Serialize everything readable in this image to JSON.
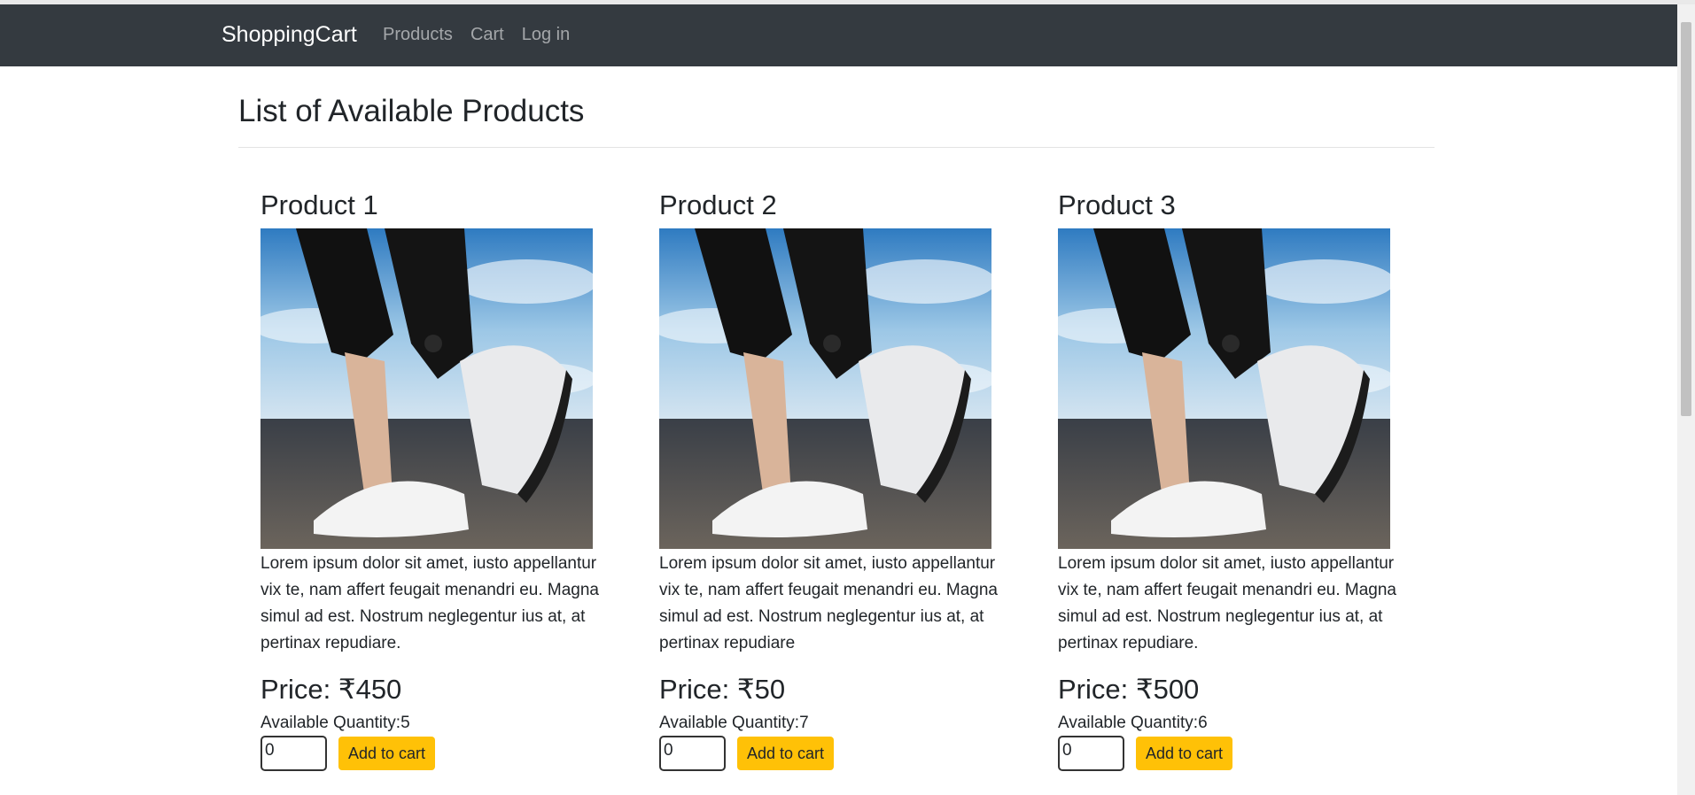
{
  "navbar": {
    "brand": "ShoppingCart",
    "links": [
      "Products",
      "Cart",
      "Log in"
    ]
  },
  "page": {
    "title": "List of Available Products"
  },
  "products": [
    {
      "name": "Product 1",
      "description": "Lorem ipsum dolor sit amet, iusto appellantur vix te, nam affert feugait menandri eu. Magna simul ad est. Nostrum neglegentur ius at, at pertinax repudiare.",
      "price": "Price: ₹450",
      "quantity": "Available Quantity:5",
      "input_value": "0",
      "button_label": "Add to cart"
    },
    {
      "name": "Product 2",
      "description": "Lorem ipsum dolor sit amet, iusto appellantur vix te, nam affert feugait menandri eu. Magna simul ad est. Nostrum neglegentur ius at, at pertinax repudiare",
      "price": "Price: ₹50",
      "quantity": "Available Quantity:7",
      "input_value": "0",
      "button_label": "Add to cart"
    },
    {
      "name": "Product 3",
      "description": "Lorem ipsum dolor sit amet, iusto appellantur vix te, nam affert feugait menandri eu. Magna simul ad est. Nostrum neglegentur ius at, at pertinax repudiare.",
      "price": "Price: ₹500",
      "quantity": "Available Quantity:6",
      "input_value": "0",
      "button_label": "Add to cart"
    }
  ],
  "colors": {
    "navbar_bg": "#343a40",
    "button_bg": "#ffc107"
  }
}
